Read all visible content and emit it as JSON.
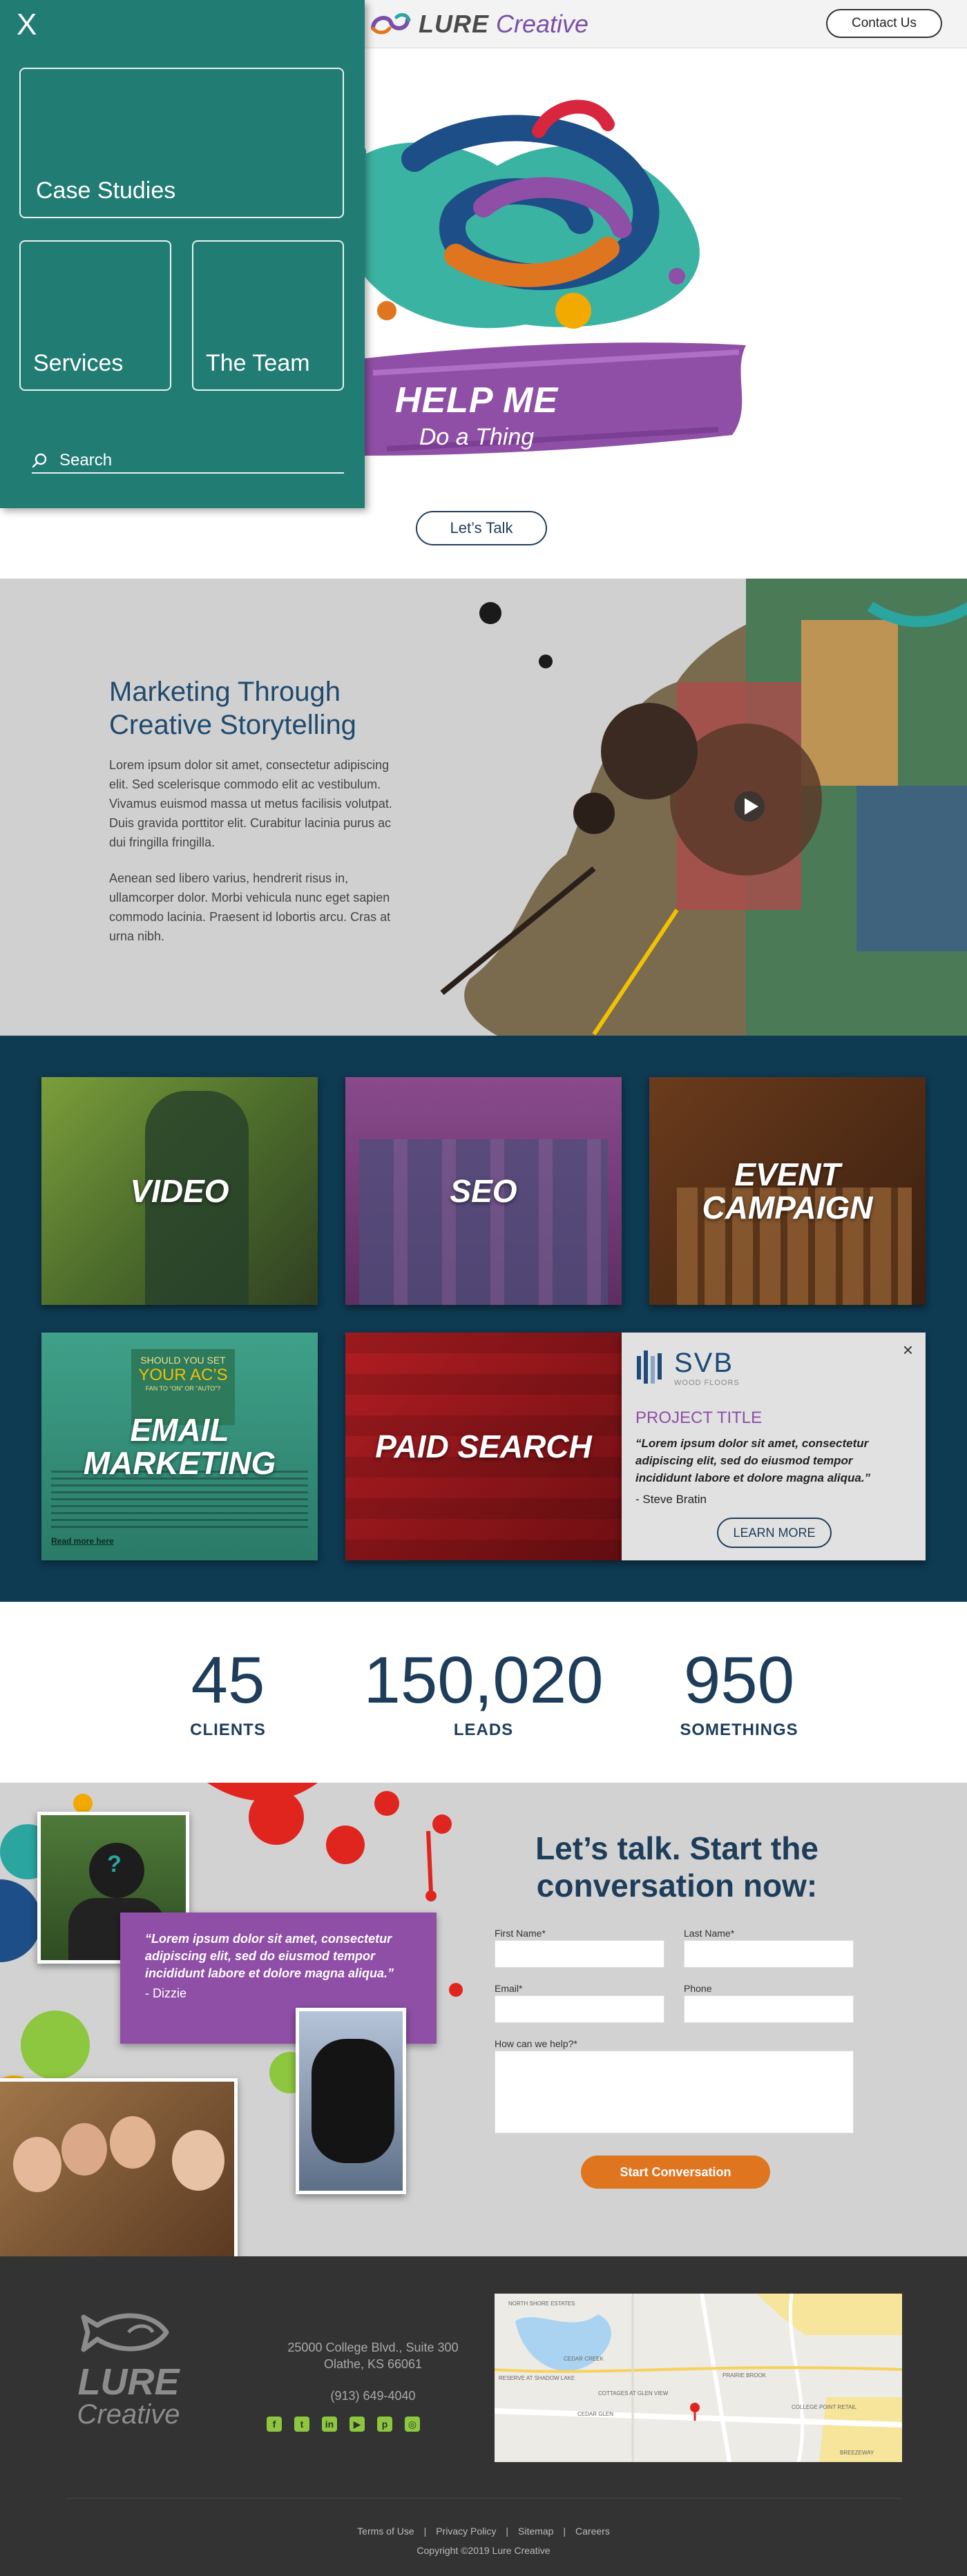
{
  "header": {
    "logo_bold": "LURE",
    "logo_light": "Creative",
    "contact_label": "Contact Us"
  },
  "menu": {
    "close_label": "X",
    "tiles": [
      "Case Studies",
      "Services",
      "The Team"
    ],
    "search_label": "Search"
  },
  "hero": {
    "headline": "HELP ME",
    "subline": "Do a Thing",
    "cta_label": "Let’s Talk"
  },
  "marketing": {
    "title": "Marketing Through Creative Storytelling",
    "para1": "Lorem ipsum dolor sit amet, consectetur adipiscing elit. Sed scelerisque commodo elit ac vestibulum. Vivamus euismod massa ut metus facilisis volutpat. Duis gravida porttitor elit. Curabitur lacinia purus ac dui fringilla fringilla.",
    "para2": "Aenean sed libero varius, hendrerit risus in, ullamcorper dolor. Morbi vehicula nunc eget sapien commodo lacinia. Praesent id lobortis arcu. Cras at urna nibh."
  },
  "services": {
    "cards": [
      "VIDEO",
      "SEO",
      "EVENT CAMPAIGN",
      "EMAIL MARKETING",
      "PAID SEARCH"
    ],
    "email_card_text": {
      "line1": "SHOULD YOU SET",
      "line2": "YOUR AC’S",
      "line3": "FAN TO “ON” OR “AUTO”?",
      "read_more": "Read more here"
    },
    "testimonial": {
      "brand": "SVB",
      "brand_sub": "WOOD FLOORS",
      "project_title": "PROJECT TITLE",
      "quote": "“Lorem ipsum dolor sit amet, consectetur adipiscing elit, sed do eiusmod tempor incididunt labore et dolore magna aliqua.”",
      "author": "- Steve Bratin",
      "button": "LEARN MORE",
      "close": "×"
    }
  },
  "stats": [
    {
      "number": "45",
      "label": "CLIENTS"
    },
    {
      "number": "150,020",
      "label": "LEADS"
    },
    {
      "number": "950",
      "label": "SOMETHINGS"
    }
  ],
  "contact": {
    "title": "Let’s talk. Start the conversation now:",
    "quote": "“Lorem ipsum dolor sit amet, consectetur adipiscing elit, sed do eiusmod tempor incididunt labore et dolore magna aliqua.”",
    "quote_author": "- Dizzie",
    "labels": {
      "first_name": "First Name*",
      "last_name": "Last Name*",
      "email": "Email*",
      "phone": "Phone",
      "help": "How can we help?*"
    },
    "submit": "Start Conversation"
  },
  "footer": {
    "logo_top": "LURE",
    "logo_bottom": "Creative",
    "address_line1": "25000 College Blvd., Suite 300",
    "address_line2": "Olathe, KS 66061",
    "phone": "(913) 649-4040",
    "socials": [
      "f",
      "t",
      "in",
      "▶",
      "p",
      "◎"
    ],
    "links": [
      "Terms of Use",
      "Privacy Policy",
      "Sitemap",
      "Careers"
    ],
    "copyright": "Copyright ©2019 Lure Creative",
    "map_labels": [
      "NORTH SHORE ESTATES",
      "CEDAR CREEK",
      "RESERVE AT SHADOW LAKE",
      "COTTAGES AT GLEN VIEW",
      "CEDAR GLEN",
      "PRAIRIE BROOK",
      "COLLEGE POINT RETAIL",
      "BREEZEWAY"
    ]
  },
  "colors": {
    "menu": "#217c74",
    "navy": "#0e3a52",
    "purple": "#8f4fa6",
    "orange": "#e0751f",
    "footer": "#333333"
  }
}
